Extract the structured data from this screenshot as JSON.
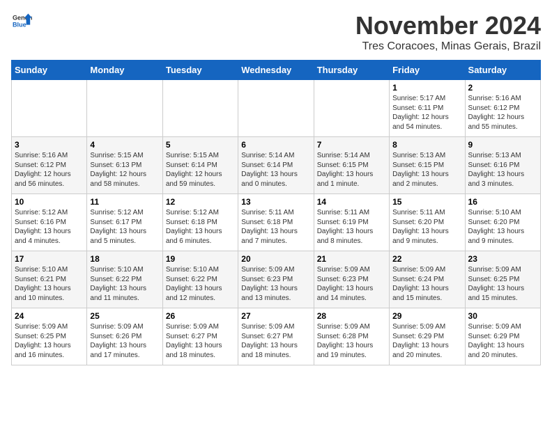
{
  "header": {
    "logo_line1": "General",
    "logo_line2": "Blue",
    "month": "November 2024",
    "location": "Tres Coracoes, Minas Gerais, Brazil"
  },
  "weekdays": [
    "Sunday",
    "Monday",
    "Tuesday",
    "Wednesday",
    "Thursday",
    "Friday",
    "Saturday"
  ],
  "weeks": [
    [
      {
        "day": "",
        "info": ""
      },
      {
        "day": "",
        "info": ""
      },
      {
        "day": "",
        "info": ""
      },
      {
        "day": "",
        "info": ""
      },
      {
        "day": "",
        "info": ""
      },
      {
        "day": "1",
        "info": "Sunrise: 5:17 AM\nSunset: 6:11 PM\nDaylight: 12 hours\nand 54 minutes."
      },
      {
        "day": "2",
        "info": "Sunrise: 5:16 AM\nSunset: 6:12 PM\nDaylight: 12 hours\nand 55 minutes."
      }
    ],
    [
      {
        "day": "3",
        "info": "Sunrise: 5:16 AM\nSunset: 6:12 PM\nDaylight: 12 hours\nand 56 minutes."
      },
      {
        "day": "4",
        "info": "Sunrise: 5:15 AM\nSunset: 6:13 PM\nDaylight: 12 hours\nand 58 minutes."
      },
      {
        "day": "5",
        "info": "Sunrise: 5:15 AM\nSunset: 6:14 PM\nDaylight: 12 hours\nand 59 minutes."
      },
      {
        "day": "6",
        "info": "Sunrise: 5:14 AM\nSunset: 6:14 PM\nDaylight: 13 hours\nand 0 minutes."
      },
      {
        "day": "7",
        "info": "Sunrise: 5:14 AM\nSunset: 6:15 PM\nDaylight: 13 hours\nand 1 minute."
      },
      {
        "day": "8",
        "info": "Sunrise: 5:13 AM\nSunset: 6:15 PM\nDaylight: 13 hours\nand 2 minutes."
      },
      {
        "day": "9",
        "info": "Sunrise: 5:13 AM\nSunset: 6:16 PM\nDaylight: 13 hours\nand 3 minutes."
      }
    ],
    [
      {
        "day": "10",
        "info": "Sunrise: 5:12 AM\nSunset: 6:16 PM\nDaylight: 13 hours\nand 4 minutes."
      },
      {
        "day": "11",
        "info": "Sunrise: 5:12 AM\nSunset: 6:17 PM\nDaylight: 13 hours\nand 5 minutes."
      },
      {
        "day": "12",
        "info": "Sunrise: 5:12 AM\nSunset: 6:18 PM\nDaylight: 13 hours\nand 6 minutes."
      },
      {
        "day": "13",
        "info": "Sunrise: 5:11 AM\nSunset: 6:18 PM\nDaylight: 13 hours\nand 7 minutes."
      },
      {
        "day": "14",
        "info": "Sunrise: 5:11 AM\nSunset: 6:19 PM\nDaylight: 13 hours\nand 8 minutes."
      },
      {
        "day": "15",
        "info": "Sunrise: 5:11 AM\nSunset: 6:20 PM\nDaylight: 13 hours\nand 9 minutes."
      },
      {
        "day": "16",
        "info": "Sunrise: 5:10 AM\nSunset: 6:20 PM\nDaylight: 13 hours\nand 9 minutes."
      }
    ],
    [
      {
        "day": "17",
        "info": "Sunrise: 5:10 AM\nSunset: 6:21 PM\nDaylight: 13 hours\nand 10 minutes."
      },
      {
        "day": "18",
        "info": "Sunrise: 5:10 AM\nSunset: 6:22 PM\nDaylight: 13 hours\nand 11 minutes."
      },
      {
        "day": "19",
        "info": "Sunrise: 5:10 AM\nSunset: 6:22 PM\nDaylight: 13 hours\nand 12 minutes."
      },
      {
        "day": "20",
        "info": "Sunrise: 5:09 AM\nSunset: 6:23 PM\nDaylight: 13 hours\nand 13 minutes."
      },
      {
        "day": "21",
        "info": "Sunrise: 5:09 AM\nSunset: 6:23 PM\nDaylight: 13 hours\nand 14 minutes."
      },
      {
        "day": "22",
        "info": "Sunrise: 5:09 AM\nSunset: 6:24 PM\nDaylight: 13 hours\nand 15 minutes."
      },
      {
        "day": "23",
        "info": "Sunrise: 5:09 AM\nSunset: 6:25 PM\nDaylight: 13 hours\nand 15 minutes."
      }
    ],
    [
      {
        "day": "24",
        "info": "Sunrise: 5:09 AM\nSunset: 6:25 PM\nDaylight: 13 hours\nand 16 minutes."
      },
      {
        "day": "25",
        "info": "Sunrise: 5:09 AM\nSunset: 6:26 PM\nDaylight: 13 hours\nand 17 minutes."
      },
      {
        "day": "26",
        "info": "Sunrise: 5:09 AM\nSunset: 6:27 PM\nDaylight: 13 hours\nand 18 minutes."
      },
      {
        "day": "27",
        "info": "Sunrise: 5:09 AM\nSunset: 6:27 PM\nDaylight: 13 hours\nand 18 minutes."
      },
      {
        "day": "28",
        "info": "Sunrise: 5:09 AM\nSunset: 6:28 PM\nDaylight: 13 hours\nand 19 minutes."
      },
      {
        "day": "29",
        "info": "Sunrise: 5:09 AM\nSunset: 6:29 PM\nDaylight: 13 hours\nand 20 minutes."
      },
      {
        "day": "30",
        "info": "Sunrise: 5:09 AM\nSunset: 6:29 PM\nDaylight: 13 hours\nand 20 minutes."
      }
    ]
  ]
}
